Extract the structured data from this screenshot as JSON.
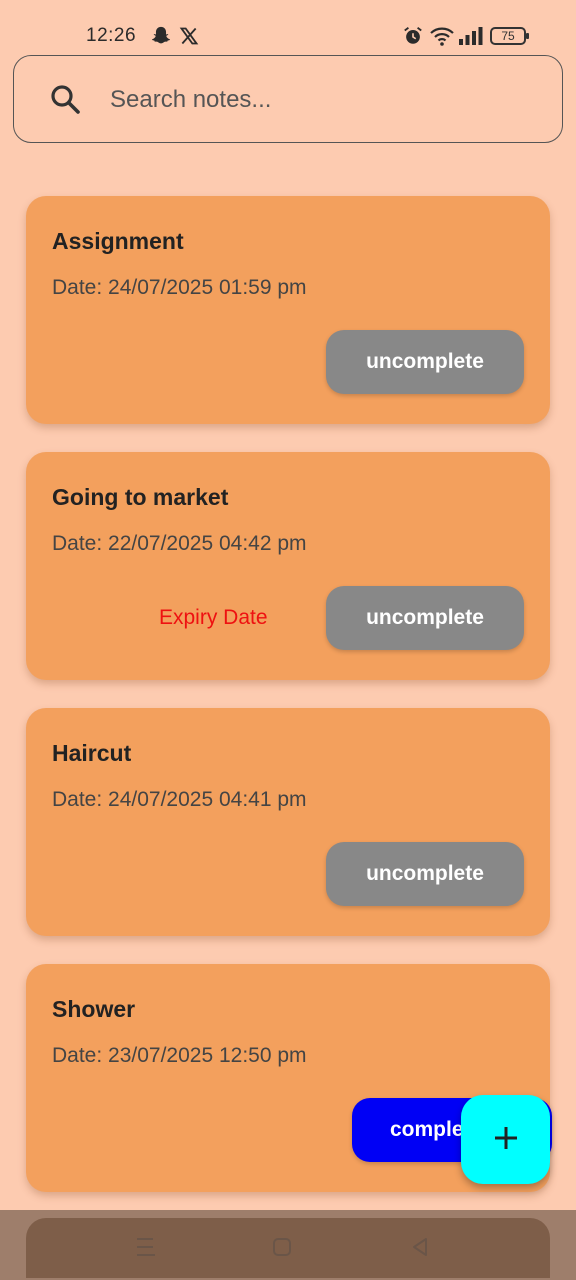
{
  "status_bar": {
    "time": "12:26",
    "battery": "75",
    "icons": [
      "snapchat-icon",
      "x-icon",
      "alarm-icon",
      "wifi-icon",
      "signal-icon",
      "battery-icon"
    ]
  },
  "search": {
    "placeholder": "Search notes...",
    "value": ""
  },
  "notes": [
    {
      "title": "Assignment",
      "date": "Date: 24/07/2025 01:59 pm",
      "status": "uncomplete",
      "expiry": ""
    },
    {
      "title": "Going to market",
      "date": "Date: 22/07/2025 04:42 pm",
      "status": "uncomplete",
      "expiry": "Expiry Date"
    },
    {
      "title": "Haircut",
      "date": "Date: 24/07/2025 04:41 pm",
      "status": "uncomplete",
      "expiry": ""
    },
    {
      "title": "Shower",
      "date": "Date: 23/07/2025 12:50 pm",
      "status": "complete",
      "expiry": ""
    }
  ],
  "fab": {
    "icon": "plus-icon"
  },
  "colors": {
    "background": "#fdcbb0",
    "card": "#f3a05d",
    "uncomplete": "#888888",
    "complete": "#0000f5",
    "expiry": "#ee1111",
    "fab": "#00ffff"
  }
}
